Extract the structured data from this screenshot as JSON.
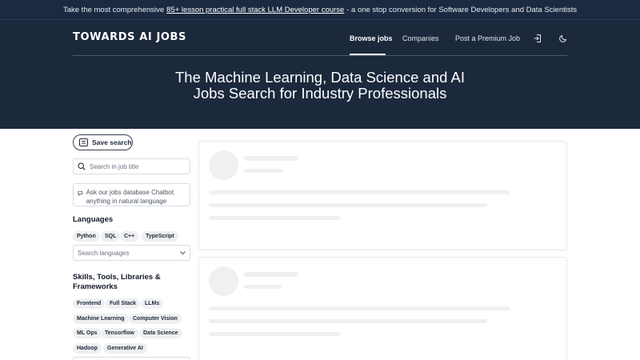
{
  "announcement": {
    "prefix": "Take the most comprehensive",
    "link": "85+ lesson practical full stack LLM Developer course",
    "suffix": "- a one stop conversion for Software Developers and Data Scientists"
  },
  "header": {
    "logo": "TOWARDS AI JOBS",
    "nav": {
      "browse_jobs": "Browse jobs",
      "companies": "Companies",
      "premium": "Post a Premium Job"
    },
    "icons": {
      "login": "login-icon",
      "theme": "moon-icon"
    }
  },
  "hero": {
    "title": "The Machine Learning, Data Science and AI Jobs Search for Industry Professionals"
  },
  "sidebar": {
    "save_search": "Save search",
    "search_placeholder": "Search in job title",
    "chatbot_text": "Ask our jobs database Chatbot anything in natural language",
    "languages": {
      "title": "Languages",
      "tags": [
        "Python",
        "SQL",
        "C++",
        "TypeScript"
      ],
      "search_placeholder": "Search languages"
    },
    "skills": {
      "title": "Skills, Tools, Libraries & Frameworks",
      "tags": [
        "Frontend",
        "Full Stack",
        "LLMs",
        "Machine Learning",
        "Computer Vision",
        "ML Ops",
        "Tensorflow",
        "Data Science",
        "Hadoop",
        "Generative AI"
      ]
    }
  },
  "colors": {
    "header_bg": "#1c293c",
    "announce_bg": "#1b2a41",
    "tag_bg": "#eef0f3",
    "skeleton": "#eef0f2"
  }
}
